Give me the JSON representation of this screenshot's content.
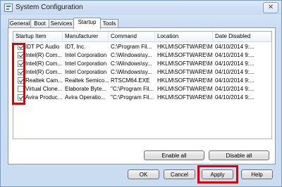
{
  "window": {
    "title": "System Configuration",
    "close_glyph": "✕",
    "highlight_color": "#e00000"
  },
  "tabs": [
    {
      "label": "General",
      "active": false
    },
    {
      "label": "Boot",
      "active": false
    },
    {
      "label": "Services",
      "active": false
    },
    {
      "label": "Startup",
      "active": true
    },
    {
      "label": "Tools",
      "active": false
    }
  ],
  "list": {
    "columns": [
      "Startup Item",
      "Manufacturer",
      "Command",
      "Location",
      "Date Disabled"
    ],
    "rows": [
      {
        "checked": true,
        "item": "IDT PC Audio",
        "manufacturer": "IDT, Inc.",
        "command": "C:\\Program Fil...",
        "location": "HKLM\\SOFTWARE\\M...",
        "date": "04/10/2014 9:..."
      },
      {
        "checked": true,
        "item": "Intel(R) Com...",
        "manufacturer": "Intel Corporation",
        "command": "C:\\Windows\\sy...",
        "location": "HKLM\\SOFTWARE\\M...",
        "date": "04/10/2014 9:..."
      },
      {
        "checked": true,
        "item": "Intel(R) Com...",
        "manufacturer": "Intel Corporation",
        "command": "C:\\Windows\\sy...",
        "location": "HKLM\\SOFTWARE\\M...",
        "date": "04/10/2014 9:..."
      },
      {
        "checked": true,
        "item": "Intel(R) Com...",
        "manufacturer": "Intel Corporation",
        "command": "C:\\Windows\\sy...",
        "location": "HKLM\\SOFTWARE\\M...",
        "date": "04/10/2014 9:..."
      },
      {
        "checked": true,
        "item": "Realtek Cam...",
        "manufacturer": "Realtek Semico...",
        "command": "RTSCM64.EXE",
        "location": "HKLM\\SOFTWARE\\M...",
        "date": "04/10/2014 9:..."
      },
      {
        "checked": false,
        "item": "Virtual Clone...",
        "manufacturer": "Elaborate Byte...",
        "command": "\"C:\\Program Fil...",
        "location": "HKLM\\SOFTWARE\\M...",
        "date": "04/10/2014 9:..."
      },
      {
        "checked": true,
        "item": "Avira Produc...",
        "manufacturer": "Avira Operatio...",
        "command": "\"C:\\Program Fil...",
        "location": "HKLM\\SOFTWARE\\M...",
        "date": "04/10/2014 9:..."
      }
    ]
  },
  "buttons": {
    "enable_all": "Enable all",
    "disable_all": "Disable all",
    "ok": "OK",
    "cancel": "Cancel",
    "apply": "Apply",
    "help": "Help"
  }
}
